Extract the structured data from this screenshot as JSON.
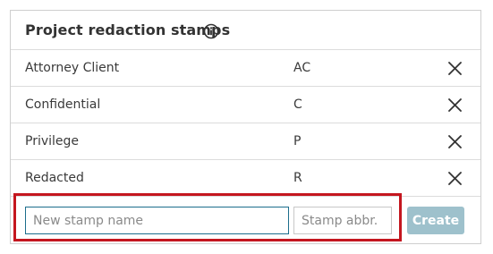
{
  "panel": {
    "title": "Project redaction stamps"
  },
  "stamps": [
    {
      "name": "Attorney Client",
      "abbr": "AC"
    },
    {
      "name": "Confidential",
      "abbr": "C"
    },
    {
      "name": "Privilege",
      "abbr": "P"
    },
    {
      "name": "Redacted",
      "abbr": "R"
    }
  ],
  "form": {
    "name_placeholder": "New stamp name",
    "abbr_placeholder": "Stamp abbr.",
    "create_label": "Create",
    "create_color": "#9ec1cc",
    "focus_border_color": "#1c6d8c",
    "highlight_color": "#c4161f"
  },
  "icons": {
    "info": "info-circle-icon",
    "delete": "close-x-icon"
  }
}
